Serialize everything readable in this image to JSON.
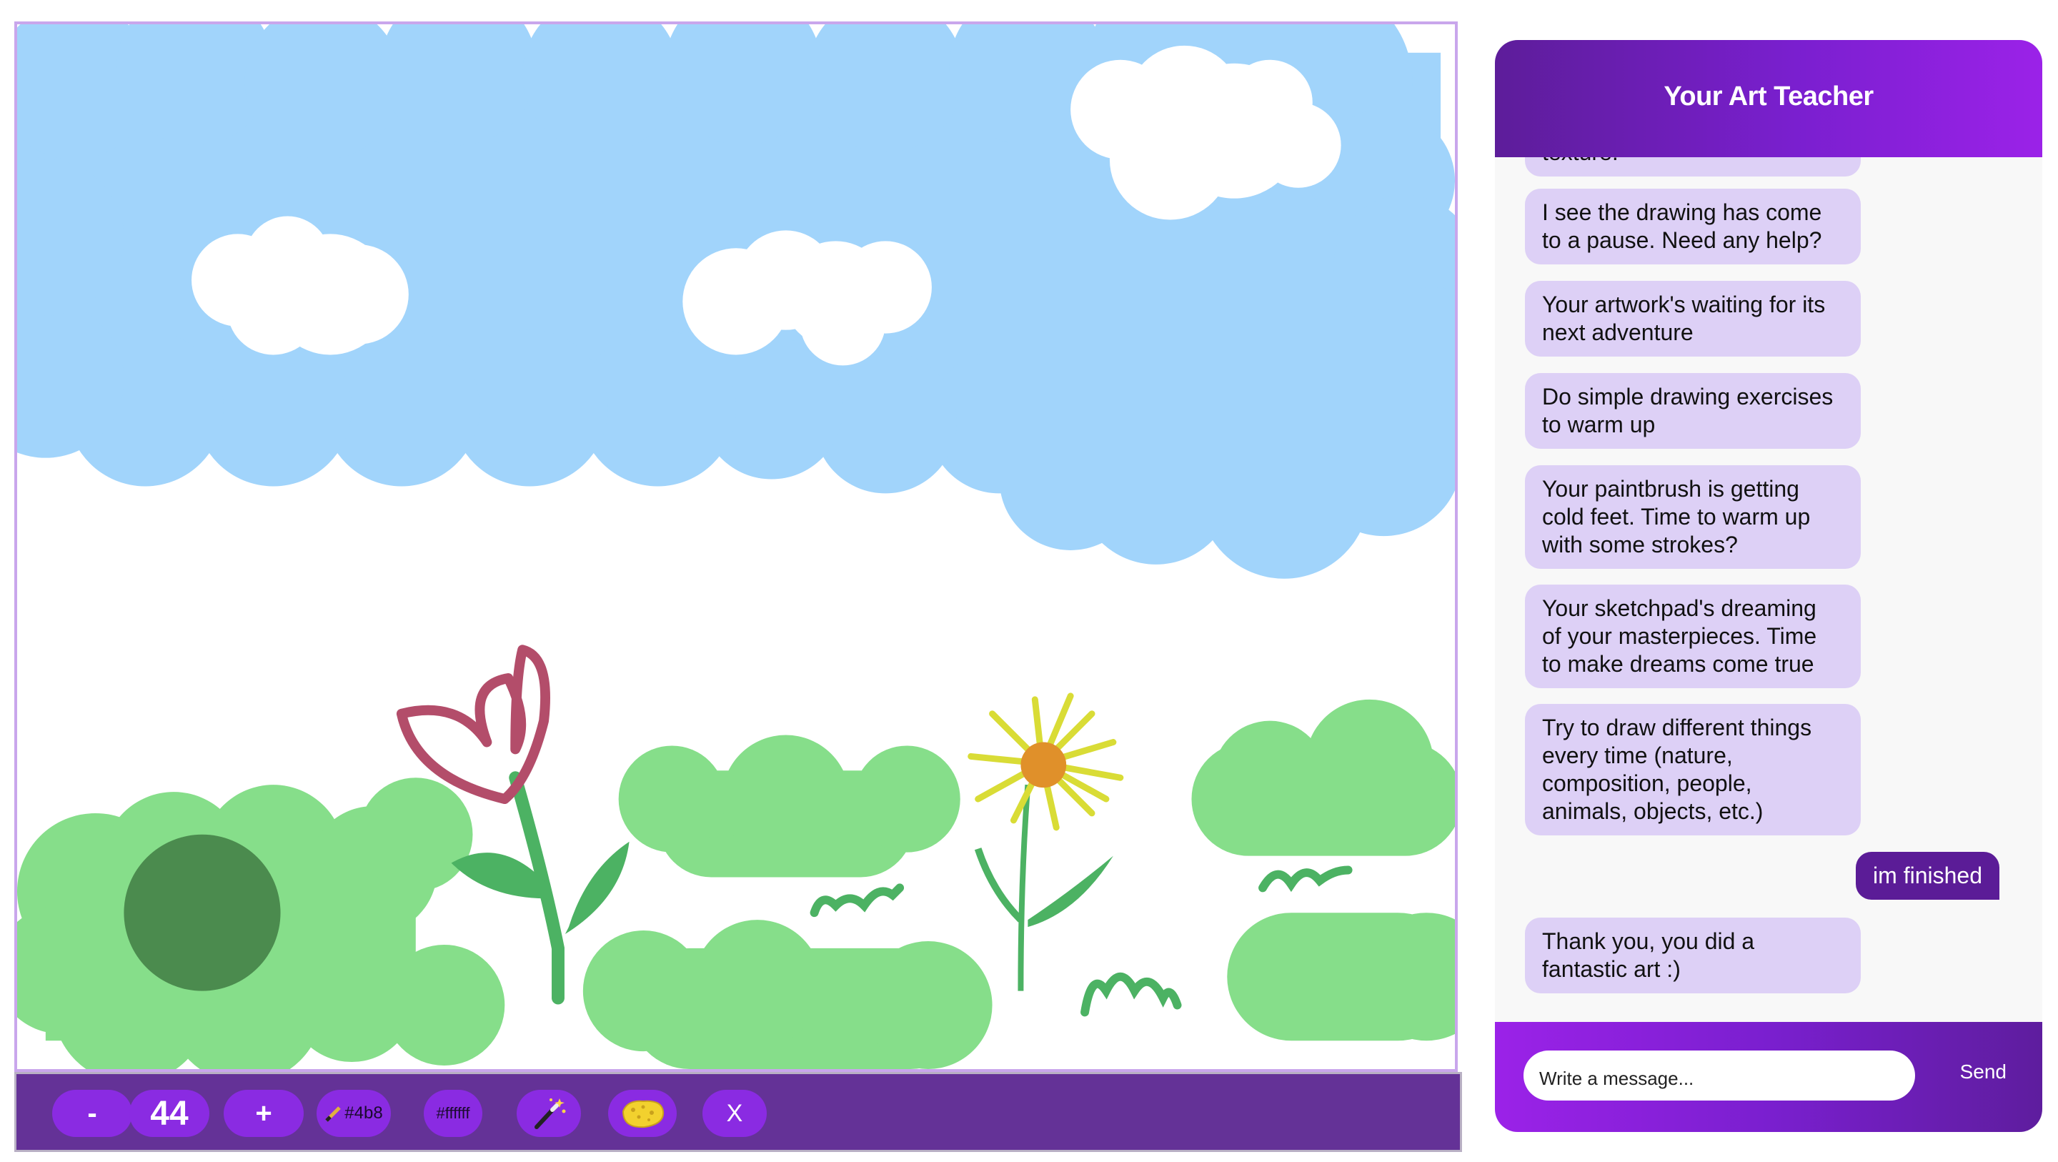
{
  "canvas": {
    "sky_color": "#a1d4fb",
    "cloud_color": "#ffffff",
    "grass_color": "#86de8a",
    "dark_bush_color": "#4b8b4e",
    "stem_color": "#4cb263",
    "tulip_color": "#b34d6a",
    "sunflower_petal_color": "#d9dc36",
    "sunflower_center_color": "#e0902a"
  },
  "toolbar": {
    "background": "#643297",
    "button_color": "#8a2be2",
    "decrease_label": "-",
    "brush_size": "44",
    "increase_label": "+",
    "brush_color_label": "#4b8",
    "background_color_label": "#ffffff",
    "magic_icon": "magic-wand-icon",
    "sponge_icon": "sponge-icon",
    "clear_label": "X"
  },
  "chat": {
    "title": "Your Art Teacher",
    "partial_message": "texture.",
    "messages": [
      {
        "role": "assistant",
        "text": "I see the drawing has come\nto a pause. Need any help?"
      },
      {
        "role": "assistant",
        "text": "Your artwork's waiting for its\nnext adventure"
      },
      {
        "role": "assistant",
        "text": "Do simple drawing exercises\nto warm up"
      },
      {
        "role": "assistant",
        "text": "Your paintbrush is getting\ncold feet. Time to warm up\nwith some strokes?"
      },
      {
        "role": "assistant",
        "text": "Your sketchpad's dreaming\nof your masterpieces. Time\nto make dreams come true"
      },
      {
        "role": "assistant",
        "text": "Try to draw different things\nevery time (nature,\ncomposition, people,\nanimals, objects, etc.)"
      },
      {
        "role": "user",
        "text": "im finished"
      },
      {
        "role": "assistant",
        "text": "Thank you, you did a\nfantastic art :)"
      }
    ],
    "input_placeholder": "Write a message...",
    "send_label": "Send"
  }
}
